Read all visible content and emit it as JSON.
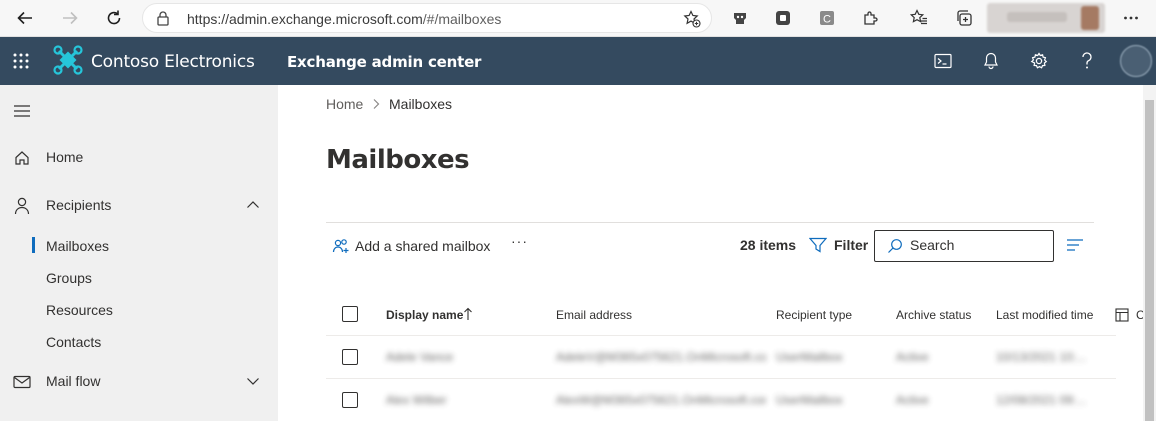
{
  "browser": {
    "url_main": "https://admin.exchange.microsoft.com",
    "url_path": "/#/mailboxes",
    "icons": [
      "back-icon",
      "forward-icon",
      "refresh-icon",
      "lock-icon",
      "add-favorite-icon",
      "extension-icons",
      "favorites-icon",
      "collections-icon",
      "more-icon"
    ]
  },
  "header": {
    "org_name": "Contoso Electronics",
    "app_name": "Exchange admin center",
    "colors": {
      "bar": "#344a5f",
      "logo": "#26c6da"
    }
  },
  "nav": {
    "home": "Home",
    "recipients": "Recipients",
    "sub": [
      "Mailboxes",
      "Groups",
      "Resources",
      "Contacts"
    ],
    "mail_flow": "Mail flow",
    "selected": "Mailboxes",
    "accent": "#0f6cbd"
  },
  "breadcrumb": {
    "home": "Home",
    "current": "Mailboxes"
  },
  "page": {
    "title": "Mailboxes"
  },
  "commands": {
    "add_shared": "Add a shared mailbox",
    "more": "···",
    "count": "28 items",
    "filter": "Filter",
    "search_placeholder": "Search"
  },
  "table": {
    "columns": [
      "Display name",
      "Email address",
      "Recipient type",
      "Archive status",
      "Last modified time",
      "C"
    ],
    "sort": "ascending",
    "rows": [
      [
        "Adele Vance",
        "AdeleV@M365x075621.OnMicrosoft.com",
        "UserMailbox",
        "Active",
        "10/13/2021 10:..."
      ],
      [
        "Alex Wilber",
        "AlexW@M365x075621.OnMicrosoft.com",
        "UserMailbox",
        "Active",
        "12/08/2021 09:..."
      ]
    ]
  }
}
